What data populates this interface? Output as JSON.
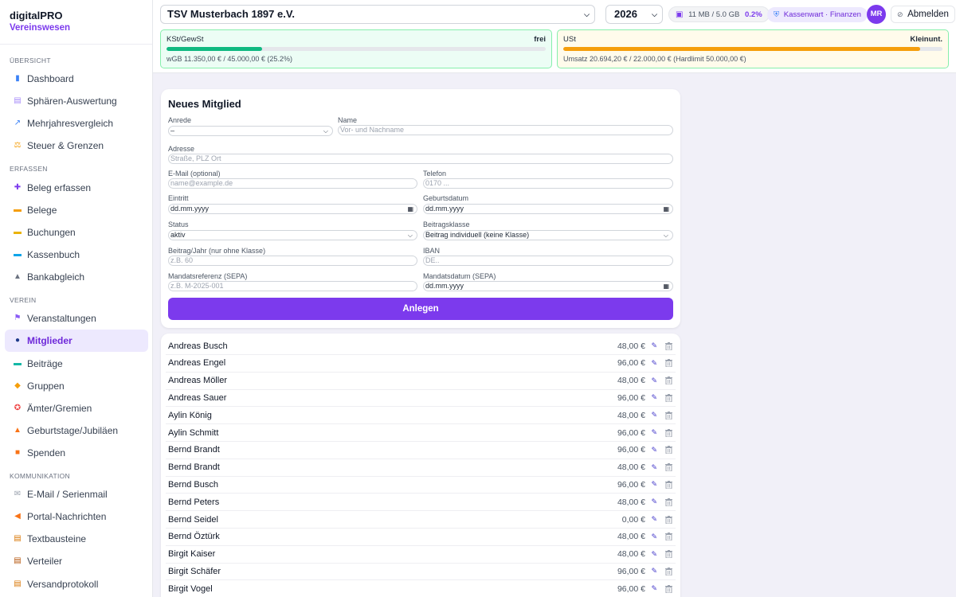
{
  "app": {
    "name": "digitalPRO",
    "module": "Vereinswesen"
  },
  "sidebar": {
    "sections": [
      {
        "title": "Übersicht",
        "items": [
          {
            "label": "Dashboard",
            "icon": "chart-icon"
          },
          {
            "label": "Sphären-Auswertung",
            "icon": "document-icon"
          },
          {
            "label": "Mehrjahresvergleich",
            "icon": "trend-icon"
          },
          {
            "label": "Steuer & Grenzen",
            "icon": "scale-icon"
          }
        ]
      },
      {
        "title": "Erfassen",
        "items": [
          {
            "label": "Beleg erfassen",
            "icon": "plus-icon"
          },
          {
            "label": "Belege",
            "icon": "folder-icon"
          },
          {
            "label": "Buchungen",
            "icon": "notepad-icon"
          },
          {
            "label": "Kassenbuch",
            "icon": "cash-icon"
          },
          {
            "label": "Bankabgleich",
            "icon": "bank-icon"
          }
        ]
      },
      {
        "title": "Verein",
        "items": [
          {
            "label": "Veranstaltungen",
            "icon": "flags-icon"
          },
          {
            "label": "Mitglieder",
            "icon": "people-icon",
            "active": true
          },
          {
            "label": "Beiträge",
            "icon": "money-icon"
          },
          {
            "label": "Gruppen",
            "icon": "tag-icon"
          },
          {
            "label": "Ämter/Gremien",
            "icon": "medal-icon"
          },
          {
            "label": "Geburtstage/Jubiläen",
            "icon": "cake-icon"
          },
          {
            "label": "Spenden",
            "icon": "gift-icon"
          }
        ]
      },
      {
        "title": "Kommunikation",
        "items": [
          {
            "label": "E-Mail / Serienmail",
            "icon": "mail-icon"
          },
          {
            "label": "Portal-Nachrichten",
            "icon": "megaphone-icon"
          },
          {
            "label": "Textbausteine",
            "icon": "memo-icon"
          },
          {
            "label": "Verteiler",
            "icon": "clipboard-icon"
          },
          {
            "label": "Versandprotokoll",
            "icon": "scroll-icon"
          }
        ]
      }
    ]
  },
  "topbar": {
    "club": "TSV Musterbach 1897 e.V.",
    "year": "2026",
    "storage_text": "11 MB / 5.0 GB",
    "storage_pct": "0.2%",
    "role": "Kassenwart · Finanzen",
    "avatar": "MR",
    "logout": "Abmelden"
  },
  "tax": {
    "kst": {
      "title": "KSt/GewSt",
      "status": "frei",
      "detail": "wGB 11.350,00 € / 45.000,00 € (25.2%)",
      "progress": 0.252,
      "color": "#10b981"
    },
    "ust": {
      "title": "USt",
      "status": "Kleinunt.",
      "detail": "Umsatz 20.694,20 € / 22.000,00 € (Hardlimit 50.000,00 €)",
      "progress": 0.9406,
      "color": "#f59e0b"
    }
  },
  "form": {
    "title": "Neues Mitglied",
    "anrede_label": "Anrede",
    "anrede_value": "–",
    "name_label": "Name",
    "name_placeholder": "Vor- und Nachname",
    "adresse_label": "Adresse",
    "adresse_placeholder": "Straße, PLZ Ort",
    "email_label": "E-Mail (optional)",
    "email_placeholder": "name@example.de",
    "telefon_label": "Telefon",
    "telefon_placeholder": "0170 ...",
    "eintritt_label": "Eintritt",
    "eintritt_value": "dd.mm.yyyy",
    "geburtsdatum_label": "Geburtsdatum",
    "geburtsdatum_value": "dd.mm.yyyy",
    "status_label": "Status",
    "status_value": "aktiv",
    "beitragsklasse_label": "Beitragsklasse",
    "beitragsklasse_value": "Beitrag individuell (keine Klasse)",
    "beitrag_label": "Beitrag/Jahr (nur ohne Klasse)",
    "beitrag_placeholder": "z.B. 60",
    "iban_label": "IBAN",
    "iban_placeholder": "DE..",
    "mandatsref_label": "Mandatsreferenz (SEPA)",
    "mandatsref_placeholder": "z.B. M-2025-001",
    "mandatsdatum_label": "Mandatsdatum (SEPA)",
    "mandatsdatum_value": "dd.mm.yyyy",
    "submit": "Anlegen"
  },
  "members": [
    {
      "name": "Andreas Busch",
      "amount": "48,00 €"
    },
    {
      "name": "Andreas Engel",
      "amount": "96,00 €"
    },
    {
      "name": "Andreas Möller",
      "amount": "48,00 €"
    },
    {
      "name": "Andreas Sauer",
      "amount": "96,00 €"
    },
    {
      "name": "Aylin König",
      "amount": "48,00 €"
    },
    {
      "name": "Aylin Schmitt",
      "amount": "96,00 €"
    },
    {
      "name": "Bernd Brandt",
      "amount": "96,00 €"
    },
    {
      "name": "Bernd Brandt",
      "amount": "48,00 €"
    },
    {
      "name": "Bernd Busch",
      "amount": "96,00 €"
    },
    {
      "name": "Bernd Peters",
      "amount": "48,00 €"
    },
    {
      "name": "Bernd Seidel",
      "amount": "0,00 €"
    },
    {
      "name": "Bernd Öztürk",
      "amount": "48,00 €"
    },
    {
      "name": "Birgit Kaiser",
      "amount": "48,00 €"
    },
    {
      "name": "Birgit Schäfer",
      "amount": "96,00 €"
    },
    {
      "name": "Birgit Vogel",
      "amount": "96,00 €"
    }
  ]
}
